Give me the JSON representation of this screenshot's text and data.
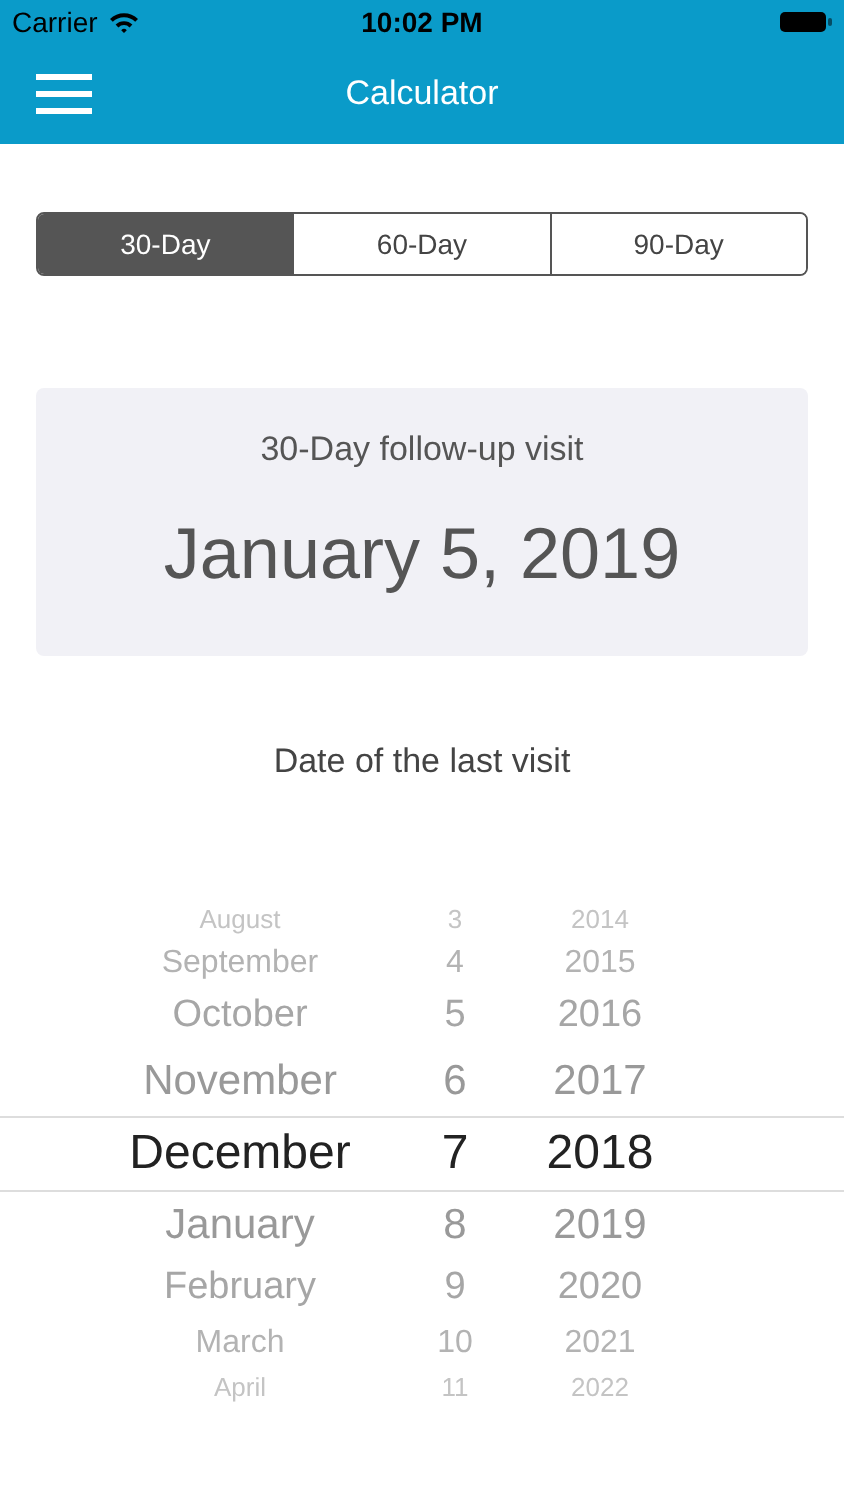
{
  "status_bar": {
    "carrier": "Carrier",
    "time": "10:02 PM"
  },
  "nav": {
    "title": "Calculator"
  },
  "tabs": [
    {
      "label": "30-Day",
      "selected": true
    },
    {
      "label": "60-Day",
      "selected": false
    },
    {
      "label": "90-Day",
      "selected": false
    }
  ],
  "result": {
    "caption": "30-Day follow-up visit",
    "date": "January 5, 2019"
  },
  "picker": {
    "label": "Date of the last visit",
    "rows": [
      {
        "month": "August",
        "day": "3",
        "year": "2014",
        "selected": false
      },
      {
        "month": "September",
        "day": "4",
        "year": "2015",
        "selected": false
      },
      {
        "month": "October",
        "day": "5",
        "year": "2016",
        "selected": false
      },
      {
        "month": "November",
        "day": "6",
        "year": "2017",
        "selected": false
      },
      {
        "month": "December",
        "day": "7",
        "year": "2018",
        "selected": true
      },
      {
        "month": "January",
        "day": "8",
        "year": "2019",
        "selected": false
      },
      {
        "month": "February",
        "day": "9",
        "year": "2020",
        "selected": false
      },
      {
        "month": "March",
        "day": "10",
        "year": "2021",
        "selected": false
      },
      {
        "month": "April",
        "day": "11",
        "year": "2022",
        "selected": false
      }
    ]
  }
}
